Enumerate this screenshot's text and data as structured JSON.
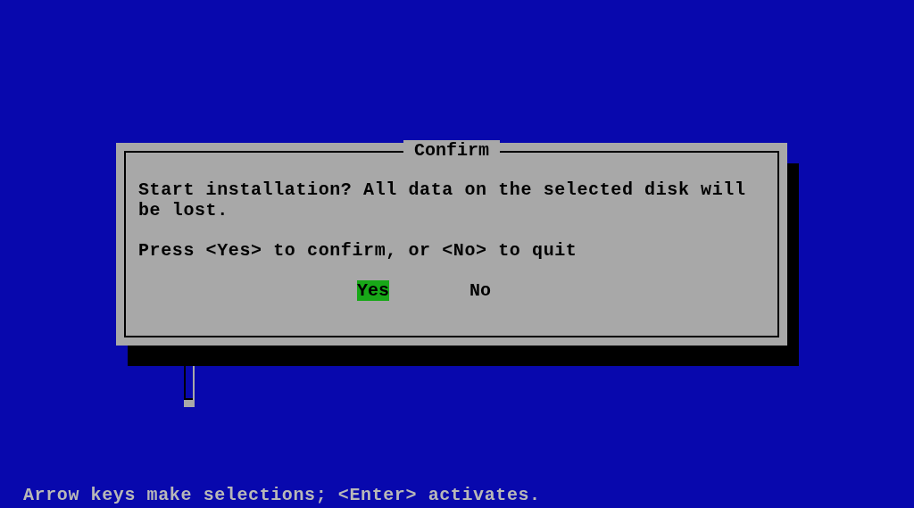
{
  "dialog": {
    "title": "Confirm",
    "message": "Start installation? All data on the selected disk will be lost.",
    "prompt": "Press <Yes> to confirm, or <No> to quit",
    "buttons": [
      {
        "label": "Yes",
        "selected": true
      },
      {
        "label": "No",
        "selected": false
      }
    ]
  },
  "status_bar": "Arrow keys make selections; <Enter> activates."
}
